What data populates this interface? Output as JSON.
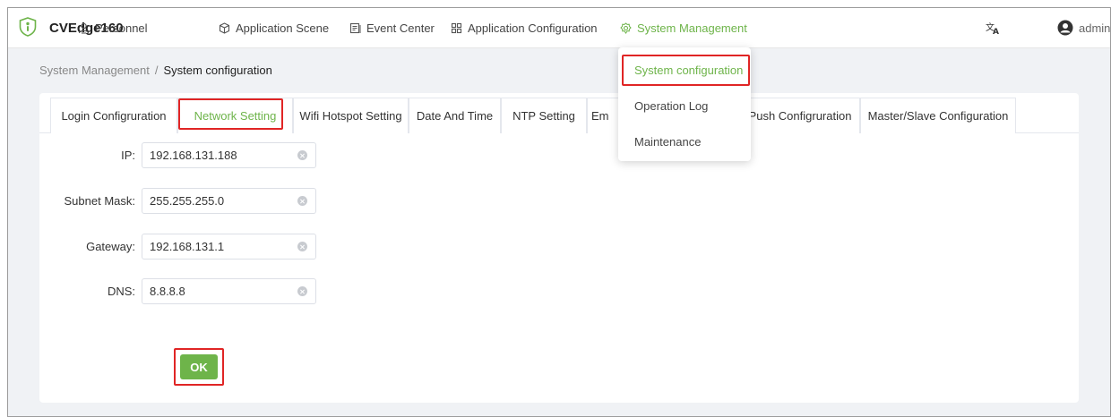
{
  "app": {
    "brand": "CVEdge160"
  },
  "nav": {
    "personnel": "Personnel",
    "application_scene": "Application Scene",
    "event_center": "Event Center",
    "application_configuration": "Application Configuration",
    "system_management": "System Management"
  },
  "user": {
    "name": "admin"
  },
  "breadcrumb": {
    "parent": "System Management",
    "separator": "/",
    "current": "System configuration"
  },
  "tabs": [
    {
      "label": "Login Configruration"
    },
    {
      "label": "Network Setting"
    },
    {
      "label": "Wifi Hotspot Setting"
    },
    {
      "label": "Date And Time"
    },
    {
      "label": "NTP Setting"
    },
    {
      "label": "Em"
    },
    {
      "label": "Push Configruration"
    },
    {
      "label": "Master/Slave Configuration"
    }
  ],
  "form": {
    "ip": {
      "label": "IP:",
      "value": "192.168.131.188"
    },
    "subnet": {
      "label": "Subnet Mask:",
      "value": "255.255.255.0"
    },
    "gateway": {
      "label": "Gateway:",
      "value": "192.168.131.1"
    },
    "dns": {
      "label": "DNS:",
      "value": "8.8.8.8"
    },
    "ok_label": "OK"
  },
  "dropdown": {
    "items": [
      {
        "label": "System configuration"
      },
      {
        "label": "Operation Log"
      },
      {
        "label": "Maintenance"
      }
    ]
  },
  "colors": {
    "accent": "#6eb44a",
    "highlight": "#e02525",
    "page_bg": "#f0f2f5"
  },
  "icons": [
    "shield-logo-icon",
    "person-icon",
    "cube-icon",
    "document-icon",
    "grid-icon",
    "gear-icon",
    "translate-icon",
    "user-avatar-icon",
    "clear-icon"
  ]
}
